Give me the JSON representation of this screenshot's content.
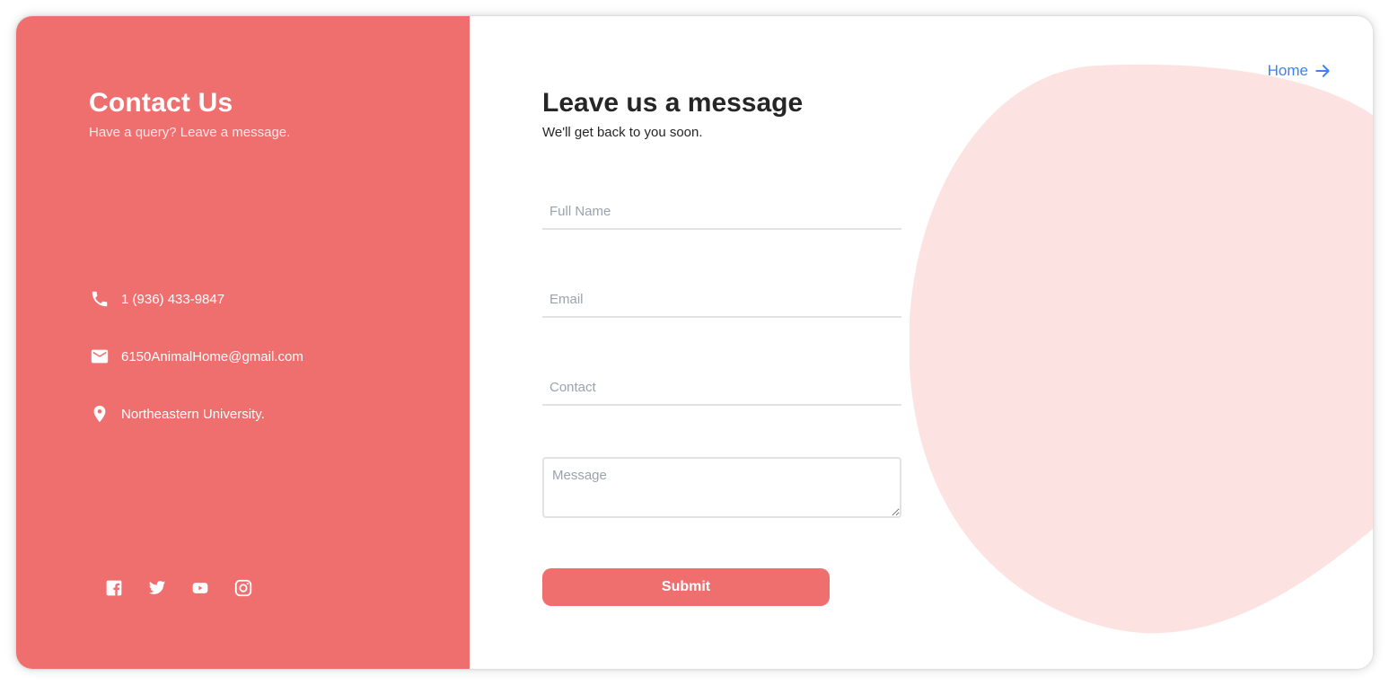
{
  "contact_panel": {
    "title": "Contact Us",
    "subtitle": "Have a query? Leave a message.",
    "info": [
      {
        "icon": "phone-icon",
        "text": "1 (936) 433-9847"
      },
      {
        "icon": "mail-icon",
        "text": "6150AnimalHome@gmail.com"
      },
      {
        "icon": "location-pin-icon",
        "text": "Northeastern University."
      }
    ],
    "socials": [
      "facebook-icon",
      "twitter-icon",
      "youtube-icon",
      "instagram-icon"
    ]
  },
  "form": {
    "home_label": "Home",
    "heading": "Leave us a message",
    "subheading": "We'll get back to you soon.",
    "full_name_placeholder": "Full Name",
    "email_placeholder": "Email",
    "contact_placeholder": "Contact",
    "message_placeholder": "Message",
    "submit_label": "Submit"
  },
  "colors": {
    "accent": "#ef6f6f",
    "blob": "#fde2e2",
    "link": "#3b82f6",
    "heading": "#262626"
  }
}
